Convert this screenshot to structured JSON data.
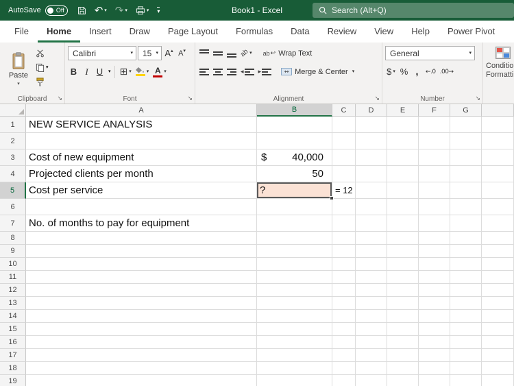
{
  "titlebar": {
    "autosave_label": "AutoSave",
    "autosave_state": "Off",
    "title": "Book1 - Excel",
    "search_placeholder": "Search (Alt+Q)"
  },
  "tabs": {
    "items": [
      "File",
      "Home",
      "Insert",
      "Draw",
      "Page Layout",
      "Formulas",
      "Data",
      "Review",
      "View",
      "Help",
      "Power Pivot"
    ],
    "active": "Home"
  },
  "ribbon": {
    "clipboard": {
      "group_label": "Clipboard",
      "paste_label": "Paste"
    },
    "font": {
      "group_label": "Font",
      "font_name": "Calibri",
      "font_size": "15",
      "bold": "B",
      "italic": "I",
      "underline": "U",
      "grow_letter": "A",
      "shrink_letter": "A",
      "font_color_letter": "A"
    },
    "alignment": {
      "group_label": "Alignment",
      "orientation_glyph": "ab",
      "wrap_icon_glyph": "ab",
      "wrap_text_label": "Wrap Text",
      "merge_center_label": "Merge & Center"
    },
    "number": {
      "group_label": "Number",
      "format": "General",
      "currency": "$",
      "percent": "%",
      "comma": ",",
      "increase_decimal_glyph": "←.0",
      "decrease_decimal_glyph": ".00→"
    },
    "styles": {
      "line1": "Conditio",
      "line2": "Formattin"
    }
  },
  "sheet": {
    "columns": [
      "A",
      "B",
      "C",
      "D",
      "E",
      "F",
      "G",
      ""
    ],
    "row_count": 19,
    "selection": {
      "column": "B",
      "row": 5,
      "cell": "B5"
    },
    "cells": [
      {
        "ref": "A1",
        "text": "NEW SERVICE ANALYSIS"
      },
      {
        "ref": "A3",
        "text": "Cost of new equipment"
      },
      {
        "ref": "B3",
        "type": "accounting",
        "prefix": "$",
        "text": "40,000"
      },
      {
        "ref": "A4",
        "text": "Projected clients per month"
      },
      {
        "ref": "B4",
        "type": "number",
        "text": "50"
      },
      {
        "ref": "A5",
        "text": "Cost per service"
      },
      {
        "ref": "B5",
        "text": "?",
        "selected": true
      },
      {
        "ref": "C5",
        "type": "note",
        "text": "= 12"
      },
      {
        "ref": "A7",
        "text": "No. of months to pay for equipment"
      }
    ]
  },
  "colors": {
    "titlebar_green": "#185C37",
    "accent_green": "#217346",
    "search_background": "#56876B",
    "ribbon_background": "#F3F2F1",
    "selected_cell_fill": "#FBE2D5",
    "selection_border": "#595959",
    "selected_header_background": "#D2D2D2",
    "selected_header_text": "#0B6A3F",
    "font_color_bar": "#C00000",
    "fill_color_bar": "#FFD400"
  }
}
